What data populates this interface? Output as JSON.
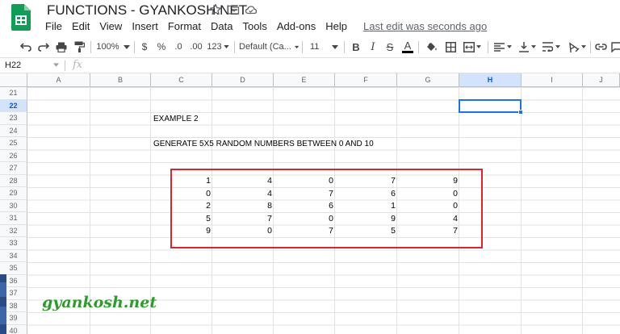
{
  "doc": {
    "title": "FUNCTIONS - GYANKOSH.NET",
    "last_edit": "Last edit was seconds ago"
  },
  "menu": [
    "File",
    "Edit",
    "View",
    "Insert",
    "Format",
    "Data",
    "Tools",
    "Add-ons",
    "Help"
  ],
  "toolbar": {
    "zoom": "100%",
    "currency": "$",
    "percent": "%",
    "dec_decrease": ".0",
    "dec_increase": ".00",
    "more_formats": "123",
    "font": "Default (Ca...",
    "font_size": "11",
    "bold": "B",
    "italic": "I",
    "strike": "S",
    "text_color": "A"
  },
  "formula_bar": {
    "name_box": "H22",
    "fx": "fx",
    "value": ""
  },
  "columns": [
    "A",
    "B",
    "C",
    "D",
    "E",
    "F",
    "G",
    "H",
    "I",
    "J"
  ],
  "active_column": "H",
  "rows": [
    "21",
    "22",
    "23",
    "24",
    "25",
    "26",
    "27",
    "28",
    "29",
    "30",
    "31",
    "32",
    "33",
    "34",
    "35",
    "36",
    "37",
    "38",
    "39",
    "40"
  ],
  "active_row": "22",
  "cells": {
    "c23": "EXAMPLE 2",
    "c25": "GENERATE 5X5 RANDOM NUMBERS BETWEEN 0 AND 10"
  },
  "matrix": [
    [
      "1",
      "4",
      "0",
      "7",
      "9"
    ],
    [
      "0",
      "4",
      "7",
      "6",
      "0"
    ],
    [
      "2",
      "8",
      "6",
      "1",
      "0"
    ],
    [
      "5",
      "7",
      "0",
      "9",
      "4"
    ],
    [
      "9",
      "0",
      "7",
      "5",
      "7"
    ]
  ],
  "watermark": "gyankosh.net",
  "colors": {
    "selection": "#1a73e8",
    "highlight_box": "#d8262e",
    "watermark": "#2f9a2d",
    "sheets_green": "#0f9d58"
  }
}
